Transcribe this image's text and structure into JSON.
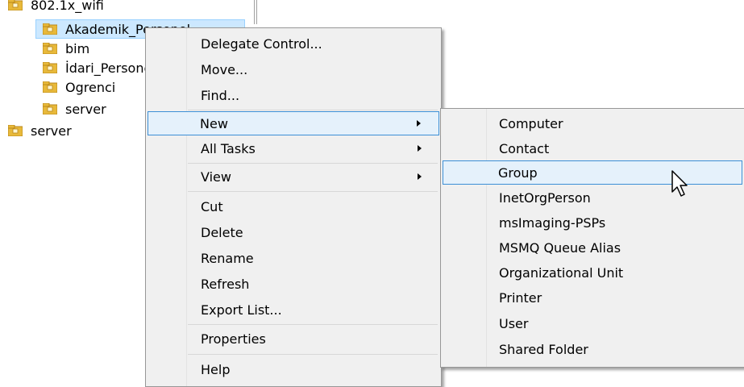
{
  "tree": {
    "items": [
      {
        "label": "802.1x_wifi"
      },
      {
        "label": "Akademik_Personel"
      },
      {
        "label": "bim"
      },
      {
        "label": "İdari_Personel"
      },
      {
        "label": "Ogrenci"
      },
      {
        "label": "server"
      },
      {
        "label": "server"
      }
    ]
  },
  "context_menu": {
    "items": [
      {
        "label": "Delegate Control..."
      },
      {
        "label": "Move..."
      },
      {
        "label": "Find..."
      },
      {
        "label": "New"
      },
      {
        "label": "All Tasks"
      },
      {
        "label": "View"
      },
      {
        "label": "Cut"
      },
      {
        "label": "Delete"
      },
      {
        "label": "Rename"
      },
      {
        "label": "Refresh"
      },
      {
        "label": "Export List..."
      },
      {
        "label": "Properties"
      },
      {
        "label": "Help"
      }
    ]
  },
  "submenu_new": {
    "items": [
      {
        "label": "Computer"
      },
      {
        "label": "Contact"
      },
      {
        "label": "Group"
      },
      {
        "label": "InetOrgPerson"
      },
      {
        "label": "msImaging-PSPs"
      },
      {
        "label": "MSMQ Queue Alias"
      },
      {
        "label": "Organizational Unit"
      },
      {
        "label": "Printer"
      },
      {
        "label": "User"
      },
      {
        "label": "Shared Folder"
      }
    ]
  },
  "colors": {
    "menu_bg": "#f0f0f0",
    "hover_bg": "#e5f1fb",
    "hover_border": "#3c8fd6",
    "folder": "#e8b93a"
  }
}
